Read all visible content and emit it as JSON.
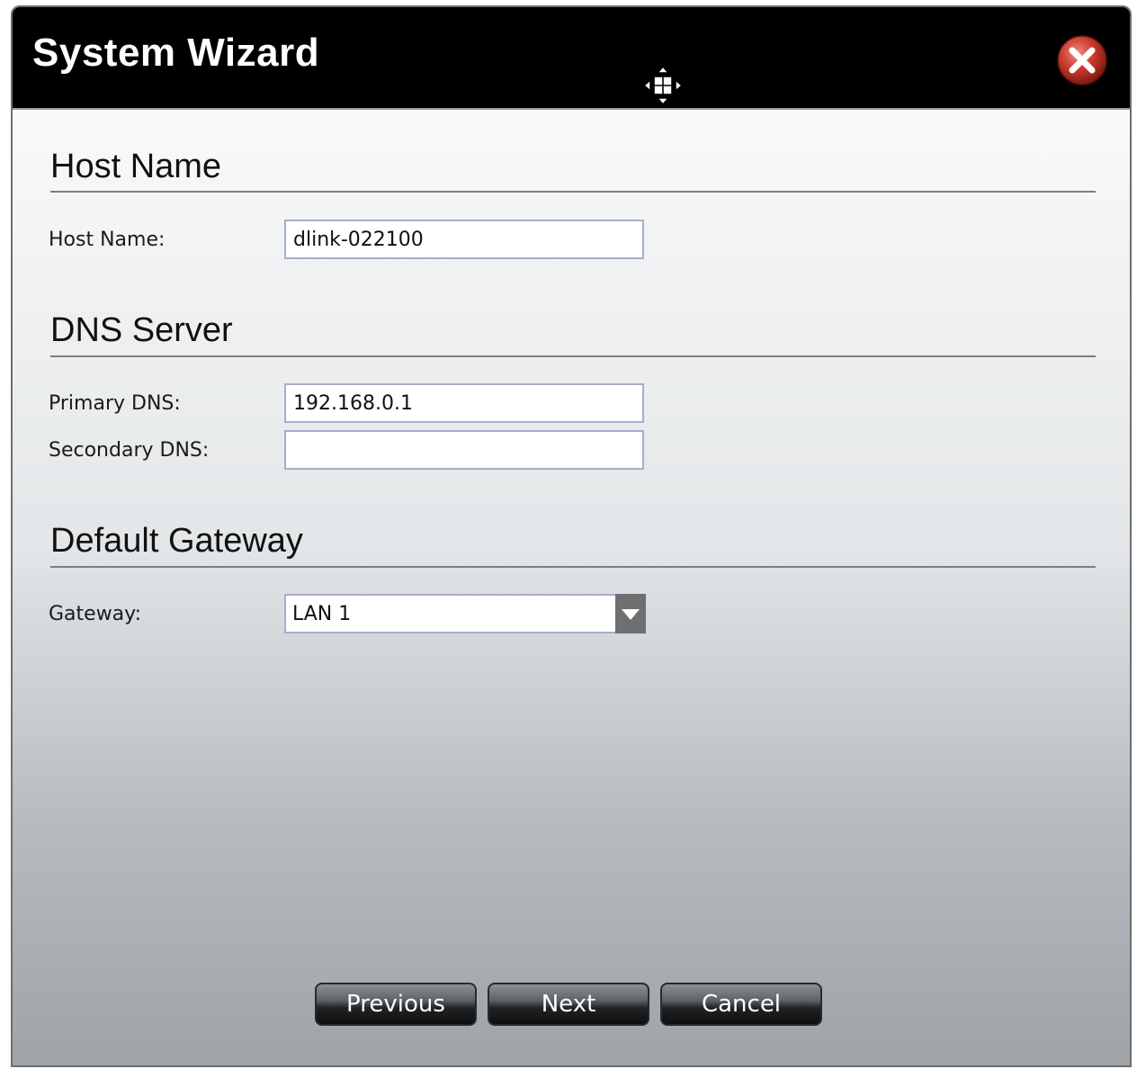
{
  "window": {
    "title": "System Wizard",
    "move_icon": "move-cursor-icon",
    "close_icon": "close-icon"
  },
  "sections": {
    "host": {
      "title": "Host Name",
      "label": "Host Name:",
      "value": "dlink-022100"
    },
    "dns": {
      "title": "DNS Server",
      "primary_label": "Primary DNS:",
      "primary_value": "192.168.0.1",
      "secondary_label": "Secondary DNS:",
      "secondary_value": ""
    },
    "gateway": {
      "title": "Default Gateway",
      "label": "Gateway:",
      "selected": "LAN 1"
    }
  },
  "buttons": {
    "previous": "Previous",
    "next": "Next",
    "cancel": "Cancel"
  },
  "colors": {
    "titlebar": "#000000",
    "close_button": "#c0392b",
    "button_dark": "#202224"
  }
}
